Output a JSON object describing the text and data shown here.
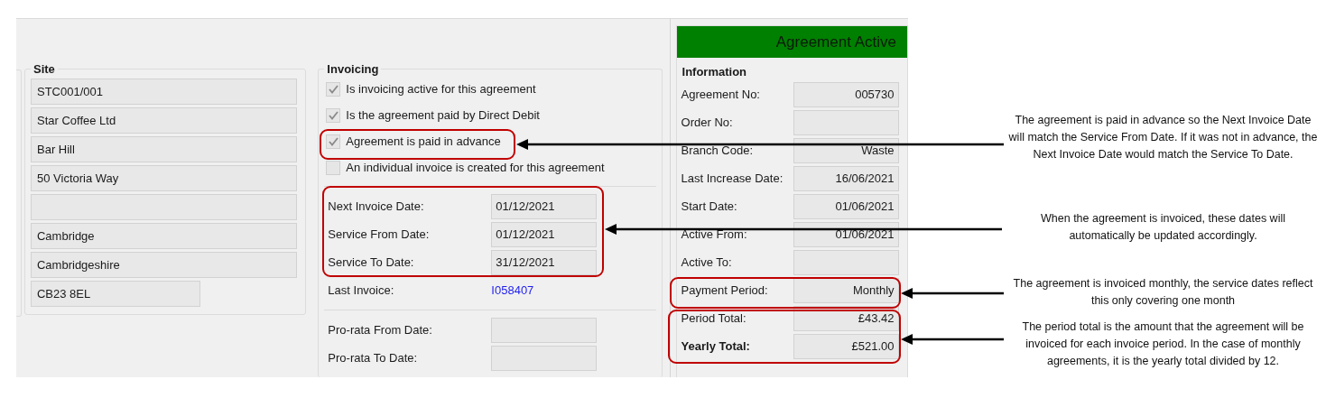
{
  "site": {
    "title": "Site",
    "fields": [
      {
        "kind": "wide",
        "value": "STC001/001"
      },
      {
        "kind": "wide",
        "value": "Star Coffee Ltd"
      },
      {
        "kind": "wide",
        "value": "Bar Hill"
      },
      {
        "kind": "wide",
        "value": "50 Victoria Way"
      },
      {
        "kind": "wide"
      },
      {
        "kind": "wide",
        "value": "Cambridge"
      },
      {
        "kind": "wide",
        "value": "Cambridgeshire"
      },
      {
        "kind": "short",
        "value": "CB23 8EL"
      }
    ]
  },
  "invoicing": {
    "title": "Invoicing",
    "options": [
      {
        "label": "Is invoicing active for this agreement",
        "checked": true
      },
      {
        "label": "Is the agreement paid by Direct Debit",
        "checked": true
      },
      {
        "label": "Agreement is paid in advance",
        "checked": true
      },
      {
        "label": "An individual invoice is created for this agreement",
        "checked": false
      }
    ],
    "dates": [
      {
        "label": "Next Invoice Date:",
        "value": "01/12/2021"
      },
      {
        "label": "Service From Date:",
        "value": "01/12/2021"
      },
      {
        "label": "Service To Date:",
        "value": "31/12/2021"
      }
    ],
    "last_invoice": {
      "label": "Last Invoice:",
      "value": "I058407"
    },
    "pro_rata": [
      {
        "label": "Pro-rata From Date:"
      },
      {
        "label": "Pro-rata To Date:"
      }
    ]
  },
  "status": {
    "text": "Agreement Active",
    "color": "#008000"
  },
  "information": {
    "title": "Information",
    "rows": [
      {
        "label": "Agreement No:",
        "value": "005730",
        "bold": false
      },
      {
        "label": "Order No:",
        "bold": false
      },
      {
        "label": "Branch Code:",
        "value": "Waste",
        "bold": false
      },
      {
        "label": "Last Increase Date:",
        "value": "16/06/2021",
        "bold": false
      },
      {
        "label": "Start Date:",
        "value": "01/06/2021",
        "bold": false
      },
      {
        "label": "Active From:",
        "value": "01/06/2021",
        "bold": false
      },
      {
        "label": "Active To:",
        "bold": false
      },
      {
        "label": "Payment Period:",
        "value": "Monthly",
        "bold": false
      },
      {
        "label": "Period Total:",
        "value": "£43.42",
        "bold": false
      },
      {
        "label": "Yearly Total:",
        "value": "£521.00",
        "bold": true
      }
    ]
  },
  "annotations": [
    {
      "text": "The agreement is paid in advance so the Next Invoice Date will match the Service From Date. If it was not in advance, the Next Invoice Date would match the Service To Date."
    },
    {
      "text": "When the agreement is invoiced, these dates will automatically be updated accordingly."
    },
    {
      "text": "The agreement is invoiced monthly, the service dates reflect this only covering one month"
    },
    {
      "text": "The period total is the amount that the agreement will be invoiced for each invoice period. In the case of monthly agreements, it is the yearly total divided by 12."
    }
  ]
}
